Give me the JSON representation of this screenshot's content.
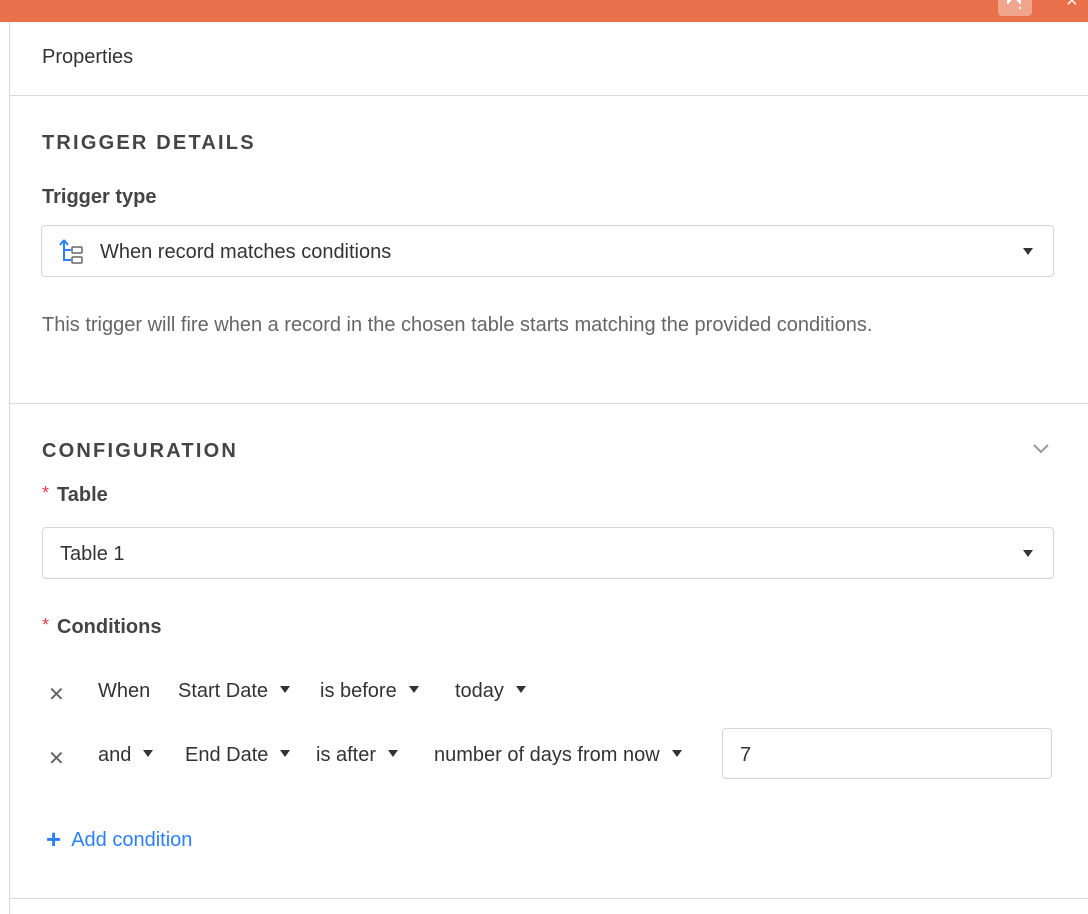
{
  "topbar": {
    "accent": "#e8704a",
    "expand_icon": "expand-icon",
    "close_icon": "close-icon",
    "close_glyph": "×"
  },
  "header": {
    "title": "Properties"
  },
  "trigger": {
    "section_title": "TRIGGER DETAILS",
    "type_label": "Trigger type",
    "type_value": "When record matches conditions",
    "type_icon": "conditions-tree-icon",
    "description": "This trigger will fire when a record in the chosen table starts matching the provided conditions."
  },
  "configuration": {
    "section_title": "CONFIGURATION",
    "collapse_icon": "chevron-down-icon",
    "table_label": "Table",
    "table_value": "Table 1",
    "conditions_label": "Conditions",
    "required_mark": "*",
    "conditions": [
      {
        "connector": "When",
        "field": "Start Date",
        "operator": "is before",
        "value": "today"
      },
      {
        "connector": "and",
        "field": "End Date",
        "operator": "is after",
        "value": "number of days from now",
        "input_value": "7"
      }
    ],
    "remove_glyph": "✕",
    "add_condition": "Add condition",
    "add_glyph": "+"
  }
}
